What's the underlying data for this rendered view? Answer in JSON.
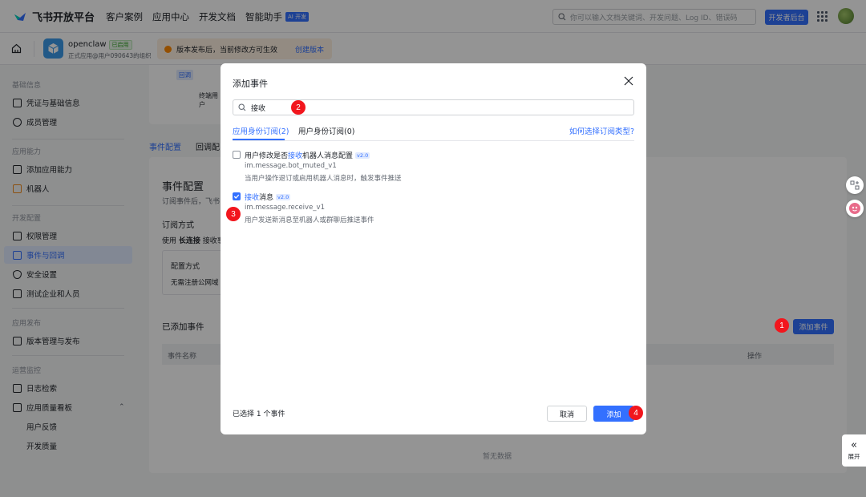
{
  "topnav": {
    "logo_text": "飞书开放平台",
    "links": [
      "客户案例",
      "应用中心",
      "开发文档",
      "智能助手"
    ],
    "ai_badge": "AI 开发",
    "search_placeholder": "你可以输入文档关键词、开发问题、Log ID、错误码",
    "dev_console": "开发者后台"
  },
  "appbar": {
    "app_name": "openclaw",
    "app_status": "已启用",
    "app_sub": "正式应用@用户090643的组织",
    "notice_text": "版本发布后，当前修改方可生效",
    "notice_link": "创建版本"
  },
  "sidebar": {
    "groups": [
      "基础信息",
      "应用能力",
      "开发配置",
      "应用发布",
      "运营监控"
    ],
    "items": [
      "凭证与基础信息",
      "成员管理",
      "添加应用能力",
      "机器人",
      "权限管理",
      "事件与回调",
      "安全设置",
      "测试企业和人员",
      "版本管理与发布",
      "日志检索",
      "应用质量看板",
      "用户反馈",
      "开发质量"
    ]
  },
  "main": {
    "card_label": "回调",
    "card_sub": "终端用户",
    "tabs": [
      "事件配置",
      "回调配"
    ],
    "title": "事件配置",
    "sub": "订阅事件后，飞书",
    "sub_method": "订阅方式",
    "use_text": "使用",
    "use_bold": "长连接",
    "use_rest": "接收事",
    "config_label": "配置方式",
    "config_val": "无需注册公网域",
    "added_title": "已添加事件",
    "add_event_btn": "添加事件",
    "col_name": "事件名称",
    "col_action": "操作",
    "empty": "暂无数据"
  },
  "floats": {
    "expand_label": "展开"
  },
  "modal": {
    "title": "添加事件",
    "search_value": "接收",
    "tabs": [
      "应用身份订阅(2)",
      "用户身份订阅(0)"
    ],
    "help_link": "如何选择订阅类型?",
    "events": [
      {
        "pre": "用户修改是否",
        "hl": "接收",
        "post": "机器人消息配置",
        "version": "v2.0",
        "key": "im.message.bot_muted_v1",
        "desc": "当用户操作退订或启用机器人消息时，触发事件推送",
        "checked": false
      },
      {
        "pre": "",
        "hl": "接收",
        "post": "消息",
        "version": "v2.0",
        "key": "im.message.receive_v1",
        "desc": "用户发送新消息至机器人或群聊后推送事件",
        "checked": true
      }
    ],
    "selected_text": "已选择 1 个事件",
    "cancel": "取消",
    "add": "添加"
  },
  "steps": [
    "1",
    "2",
    "3",
    "4"
  ],
  "colors": {
    "accent": "#3370ff",
    "step": "#f2161d"
  }
}
